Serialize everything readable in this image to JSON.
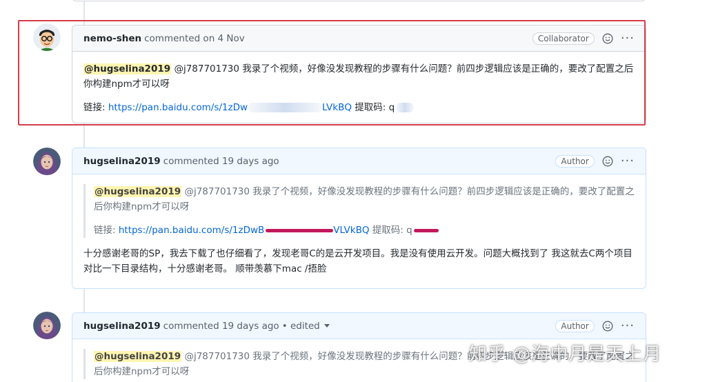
{
  "comments": [
    {
      "user": "nemo-shen",
      "meta": "commented on 4 Nov",
      "badge": "Collaborator",
      "mention": "@hugselina2019",
      "text": "@j787701730 我录了个视频，好像没发现教程的步骤有什么问题？前四步逻辑应该是正确的，要改了配置之后你构建npm才可以呀",
      "link_label": "链接: ",
      "link_start": "https://pan.baidu.com/s/1zDw",
      "link_end": "LVkBQ",
      "code_label": " 提取码: ",
      "code_visible": "q"
    },
    {
      "user": "hugselina2019",
      "meta": "commented 19 days ago",
      "badge": "Author",
      "quote_mention": "@hugselina2019",
      "quote_text": "@j787701730 我录了个视频，好像没发现教程的步骤有什么问题？前四步逻辑应该是正确的，要改了配置之后你构建npm才可以呀",
      "quote_link_label": "链接: ",
      "quote_link_start": "https://pan.baidu.com/s/1zDwB",
      "quote_link_end": "VLVkBQ",
      "quote_code_label": " 提取码: ",
      "quote_code_visible": "q",
      "reply": "十分感谢老哥的SP，我去下载了也仔细看了，发现老哥C的是云开发项目。我是没有使用云开发。问题大概找到了 我这就去C两个项目对比一下目录结构，十分感谢老哥。 顺带羡慕下mac /捂脸"
    },
    {
      "user": "hugselina2019",
      "meta": "commented 19 days ago",
      "edited": "• edited",
      "badge": "Author",
      "quote_mention": "@hugselina2019",
      "quote_text": "@j787701730 我录了个视频，好像没发现教程的步骤有什么问题？前四步逻辑应该是正确的，要改了配置之后你构建npm才可以呀"
    }
  ],
  "icons": {
    "reaction": "smiley-icon",
    "more": "kebab-icon"
  },
  "dots": "···",
  "watermark": "知乎 @海中月是天上月",
  "colors": {
    "highlight_frame": "#d73a49",
    "link": "#0366d6",
    "mention_bg": "#fff5b1",
    "author_header": "#f1f8ff"
  }
}
